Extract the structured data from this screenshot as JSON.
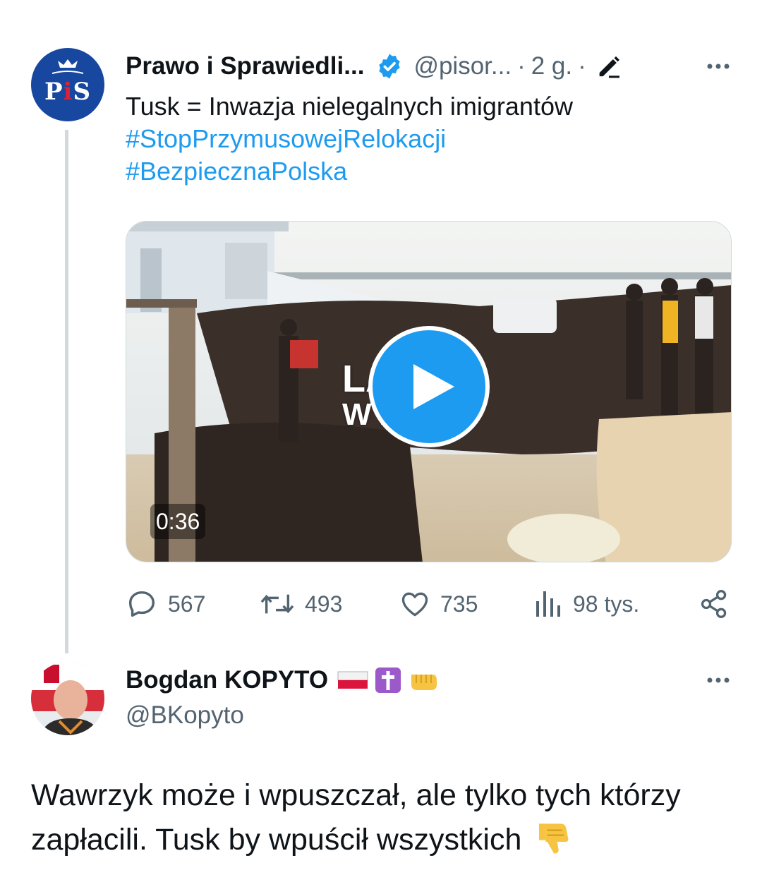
{
  "tweet": {
    "author_name": "Prawo i Sprawiedli...",
    "handle": "@pisor...",
    "separator": "·",
    "time": "2 g.",
    "avatar_text": {
      "pre": "P",
      "i": "i",
      "post": "S"
    },
    "text": "Tusk = Inwazja nielegalnych imigrantów",
    "hashtags": [
      "#StopPrzymusowejRelokacji",
      "#BezpiecznaPolska"
    ],
    "video": {
      "duration": "0:36",
      "overlay_line1": "LA      A",
      "overlay_line2": "W        23"
    },
    "stats": {
      "replies": "567",
      "retweets": "493",
      "likes": "735",
      "views": "98 tys."
    }
  },
  "reply": {
    "author_name": "Bogdan KOPYTO",
    "handle": "@BKopyto",
    "text": "Wawrzyk może i wpuszczał, ale tylko tych którzy zapłacili. Tusk by wpuścił wszystkich"
  },
  "colors": {
    "accent": "#1d9bf0",
    "muted": "#536471",
    "text": "#0f1419",
    "line": "#cfd9de",
    "pis_blue": "#17479e"
  },
  "icons": [
    "verified-icon",
    "edit-icon",
    "more-icon",
    "reply-icon",
    "retweet-icon",
    "like-icon",
    "views-icon",
    "share-icon",
    "play-icon",
    "thumbs-down-icon"
  ]
}
